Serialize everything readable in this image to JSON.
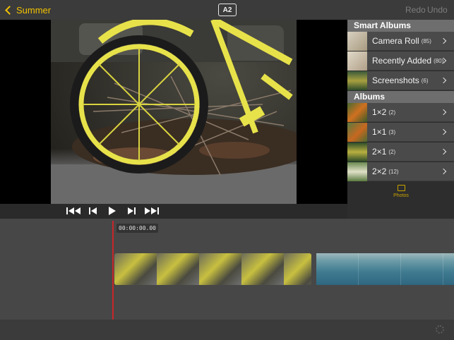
{
  "topbar": {
    "back_label": "Summer",
    "aspect_label": "A2",
    "redo_label": "Redo",
    "undo_label": "Undo"
  },
  "sidebar": {
    "smart_albums_title": "Smart Albums",
    "albums_title": "Albums",
    "smart_albums": [
      {
        "label": "Camera Roll",
        "count": "(85)"
      },
      {
        "label": "Recently Added",
        "count": "(80)"
      },
      {
        "label": "Screenshots",
        "count": "(6)"
      }
    ],
    "albums": [
      {
        "label": "1×2",
        "count": "(2)"
      },
      {
        "label": "1×1",
        "count": "(3)"
      },
      {
        "label": "2×1",
        "count": "(2)"
      },
      {
        "label": "2×2",
        "count": "(12)"
      }
    ],
    "tab_label": "Photos"
  },
  "timeline": {
    "timecode": "00:00:00.00"
  },
  "colors": {
    "accent": "#f2c200",
    "playhead": "#c8262a"
  },
  "icons": {
    "back": "chevron-left-icon",
    "skip_start": "skip-to-start-icon",
    "step_back": "step-back-icon",
    "play": "play-icon",
    "step_forward": "step-forward-icon",
    "skip_end": "skip-to-end-icon",
    "photos_tab": "photos-icon",
    "settings": "gear-icon"
  }
}
